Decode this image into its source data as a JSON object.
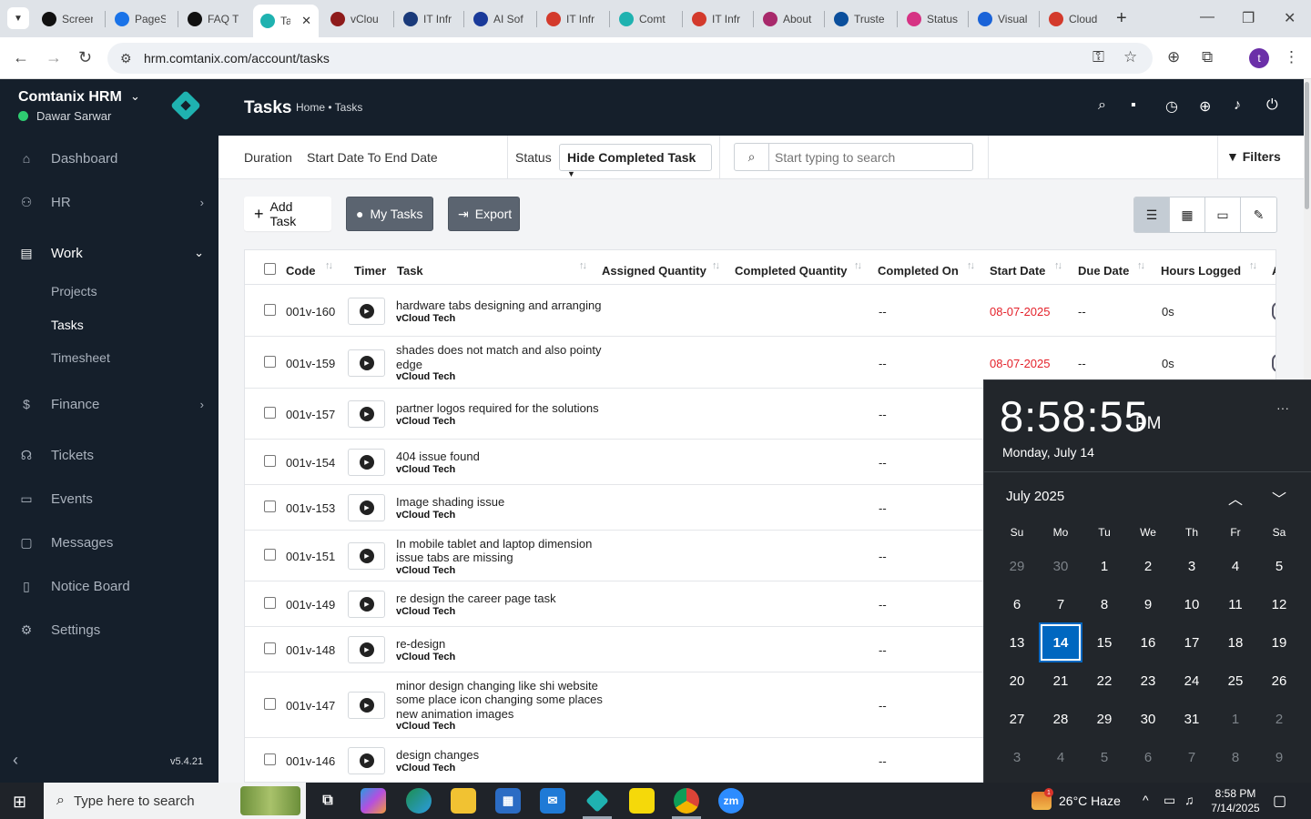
{
  "browser": {
    "tabs": [
      {
        "title": "Screen",
        "icon": "github-icon",
        "color": "#111111"
      },
      {
        "title": "PageS",
        "icon": "speed-icon",
        "color": "#1a73e8"
      },
      {
        "title": "FAQ T",
        "icon": "openai-icon",
        "color": "#111111"
      },
      {
        "title": "Ta",
        "icon": "comtanix-icon",
        "color": "#1fb2b0",
        "active": true
      },
      {
        "title": "vClou",
        "icon": "vcloud-icon",
        "color": "#8e1b1b"
      },
      {
        "title": "IT Infr",
        "icon": "pen-icon",
        "color": "#1a3a7a"
      },
      {
        "title": "AI Sof",
        "icon": "x-brand-icon",
        "color": "#1a3a9a"
      },
      {
        "title": "IT Infr",
        "icon": "shield-icon",
        "color": "#d33a2c"
      },
      {
        "title": "Comt",
        "icon": "comtanix-icon",
        "color": "#1fb2b0"
      },
      {
        "title": "IT Infr",
        "icon": "shield-icon",
        "color": "#d33a2c"
      },
      {
        "title": "About",
        "icon": "swirl-icon",
        "color": "#a8296b"
      },
      {
        "title": "Truste",
        "icon": "scale-icon",
        "color": "#0b4f9c"
      },
      {
        "title": "Status",
        "icon": "feather-icon",
        "color": "#d63384"
      },
      {
        "title": "Visual",
        "icon": "vworld-icon",
        "color": "#1a63d8"
      },
      {
        "title": "Cloud",
        "icon": "cloud-slash-icon",
        "color": "#d33a2c"
      }
    ],
    "url": "hrm.comtanix.com/account/tasks"
  },
  "sidebar": {
    "company": "Comtanix HRM",
    "user": "Dawar Sarwar",
    "items": [
      {
        "label": "Dashboard",
        "icon": "home-icon"
      },
      {
        "label": "HR",
        "icon": "users-icon"
      },
      {
        "label": "Work",
        "icon": "briefcase-icon"
      },
      {
        "label": "Finance",
        "icon": "dollar-icon"
      },
      {
        "label": "Tickets",
        "icon": "headset-icon"
      },
      {
        "label": "Events",
        "icon": "calendar-icon"
      },
      {
        "label": "Messages",
        "icon": "message-icon"
      },
      {
        "label": "Notice Board",
        "icon": "clipboard-icon"
      },
      {
        "label": "Settings",
        "icon": "gear-icon"
      }
    ],
    "work_sub": [
      "Projects",
      "Tasks",
      "Timesheet"
    ],
    "version": "v5.4.21"
  },
  "header": {
    "title": "Tasks",
    "breadcrumb": "Home • Tasks"
  },
  "filters": {
    "duration_label": "Duration",
    "duration_value": "Start Date To End Date",
    "status_label": "Status",
    "status_value": "Hide Completed Task",
    "search_placeholder": "Start typing to search",
    "filters_label": "Filters"
  },
  "actions": {
    "add_task": "Add Task",
    "my_tasks": "My Tasks",
    "export": "Export"
  },
  "table": {
    "columns": [
      "Code",
      "Timer",
      "Task",
      "Assigned Quantity",
      "Completed Quantity",
      "Completed On",
      "Start Date",
      "Due Date",
      "Hours Logged",
      "A"
    ],
    "rows": [
      {
        "code": "001v-160",
        "task": "hardware tabs designing and arranging",
        "project": "vCloud Tech",
        "completed_on": "--",
        "start": "08-07-2025",
        "due": "--",
        "hours": "0s"
      },
      {
        "code": "001v-159",
        "task": "shades does not match and also pointy edge",
        "project": "vCloud Tech",
        "completed_on": "--",
        "start": "08-07-2025",
        "due": "--",
        "hours": "0s"
      },
      {
        "code": "001v-157",
        "task": "partner logos required for the solutions",
        "project": "vCloud Tech",
        "completed_on": "--",
        "start": "",
        "due": "",
        "hours": ""
      },
      {
        "code": "001v-154",
        "task": "404 issue found",
        "project": "vCloud Tech",
        "completed_on": "--",
        "start": "",
        "due": "",
        "hours": ""
      },
      {
        "code": "001v-153",
        "task": "Image shading issue",
        "project": "vCloud Tech",
        "completed_on": "--",
        "start": "",
        "due": "",
        "hours": ""
      },
      {
        "code": "001v-151",
        "task": "In mobile tablet and laptop dimension issue tabs are missing",
        "project": "vCloud Tech",
        "completed_on": "--",
        "start": "",
        "due": "",
        "hours": ""
      },
      {
        "code": "001v-149",
        "task": "re design the career page task",
        "project": "vCloud Tech",
        "completed_on": "--",
        "start": "",
        "due": "",
        "hours": ""
      },
      {
        "code": "001v-148",
        "task": "re-design",
        "project": "vCloud Tech",
        "completed_on": "--",
        "start": "",
        "due": "",
        "hours": ""
      },
      {
        "code": "001v-147",
        "task": "minor design changing like shi website some place icon changing some places new animation images",
        "project": "vCloud Tech",
        "completed_on": "--",
        "start": "",
        "due": "",
        "hours": ""
      },
      {
        "code": "001v-146",
        "task": "design changes",
        "project": "vCloud Tech",
        "completed_on": "--",
        "start": "",
        "due": "",
        "hours": ""
      }
    ]
  },
  "clock_flyout": {
    "time": "8:58:55",
    "ampm": "PM",
    "date": "Monday, July 14",
    "month": "July 2025",
    "weekdays": [
      "Su",
      "Mo",
      "Tu",
      "We",
      "Th",
      "Fr",
      "Sa"
    ],
    "days": [
      [
        "29",
        "30",
        "1",
        "2",
        "3",
        "4",
        "5"
      ],
      [
        "6",
        "7",
        "8",
        "9",
        "10",
        "11",
        "12"
      ],
      [
        "13",
        "14",
        "15",
        "16",
        "17",
        "18",
        "19"
      ],
      [
        "20",
        "21",
        "22",
        "23",
        "24",
        "25",
        "26"
      ],
      [
        "27",
        "28",
        "29",
        "30",
        "31",
        "1",
        "2"
      ],
      [
        "3",
        "4",
        "5",
        "6",
        "7",
        "8",
        "9"
      ]
    ],
    "today": "14"
  },
  "taskbar": {
    "search_placeholder": "Type here to search",
    "weather": "26°C  Haze",
    "weather_badge": "1",
    "time": "8:58 PM",
    "date": "7/14/2025"
  }
}
